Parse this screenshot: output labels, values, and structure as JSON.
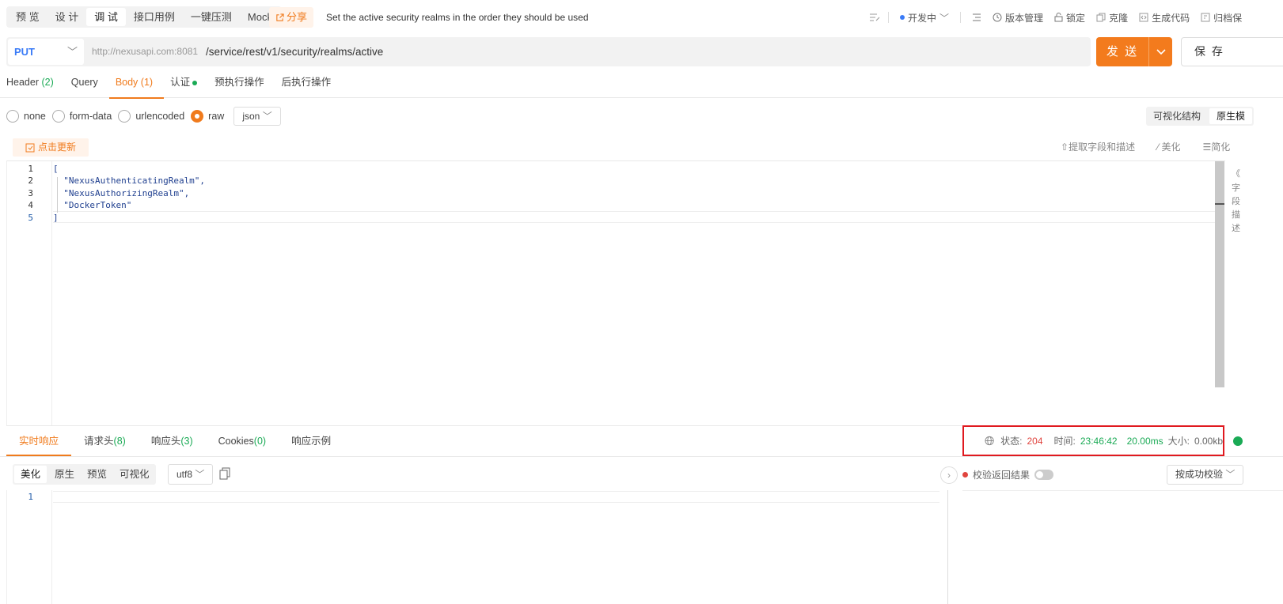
{
  "mode_tabs": [
    "预 览",
    "设 计",
    "调 试",
    "接口用例",
    "一键压测",
    "Mock"
  ],
  "share_label": "分享",
  "description": "Set the active security realms in the order they should be used",
  "toolbar": {
    "env": "开发中",
    "version": "版本管理",
    "lock": "锁定",
    "clone": "克隆",
    "gencode": "生成代码",
    "archive": "归档保"
  },
  "request": {
    "method": "PUT",
    "host": "http://nexusapi.com:8081",
    "path": "/service/rest/v1/security/realms/active",
    "send_label": "发 送",
    "save_label": "保 存"
  },
  "req_tabs": [
    {
      "label": "Header",
      "count": "(2)"
    },
    {
      "label": "Query",
      "count": ""
    },
    {
      "label": "Body",
      "count": "(1)"
    },
    {
      "label": "认证",
      "count": ""
    },
    {
      "label": "预执行操作",
      "count": ""
    },
    {
      "label": "后执行操作",
      "count": ""
    }
  ],
  "body_types": [
    "none",
    "form-data",
    "urlencoded",
    "raw"
  ],
  "body_format": "json",
  "view_modes": [
    "可视化结构",
    "原生模"
  ],
  "update_label": "点击更新",
  "editor_tools": [
    "提取字段和描述",
    "美化",
    "简化"
  ],
  "code_lines": [
    "[",
    "  \"NexusAuthenticatingRealm\",",
    "  \"NexusAuthorizingRealm\",",
    "  \"DockerToken\"",
    "]"
  ],
  "line_numbers": [
    "1",
    "2",
    "3",
    "4",
    "5"
  ],
  "right_strip": [
    "《",
    "字",
    "段",
    "描",
    "述"
  ],
  "resp_tabs": [
    {
      "label": "实时响应",
      "count": ""
    },
    {
      "label": "请求头",
      "count": "(8)"
    },
    {
      "label": "响应头",
      "count": "(3)"
    },
    {
      "label": "Cookies",
      "count": "(0)"
    },
    {
      "label": "响应示例",
      "count": ""
    }
  ],
  "status": {
    "status_label": "状态:",
    "status_code": "204",
    "time_label": "时间:",
    "time_value": "23:46:42",
    "duration": "20.00ms",
    "size_label": "大小:",
    "size_value": "0.00kb"
  },
  "resp_views": [
    "美化",
    "原生",
    "预览",
    "可视化"
  ],
  "resp_encoding": "utf8",
  "resp_line_number": "1",
  "validate_label": "校验返回结果",
  "validate_mode": "按成功校验",
  "colors": {
    "accent": "#f37b1d",
    "success": "#1aaa55",
    "error": "#e0443e",
    "method": "#3a7bf7"
  }
}
